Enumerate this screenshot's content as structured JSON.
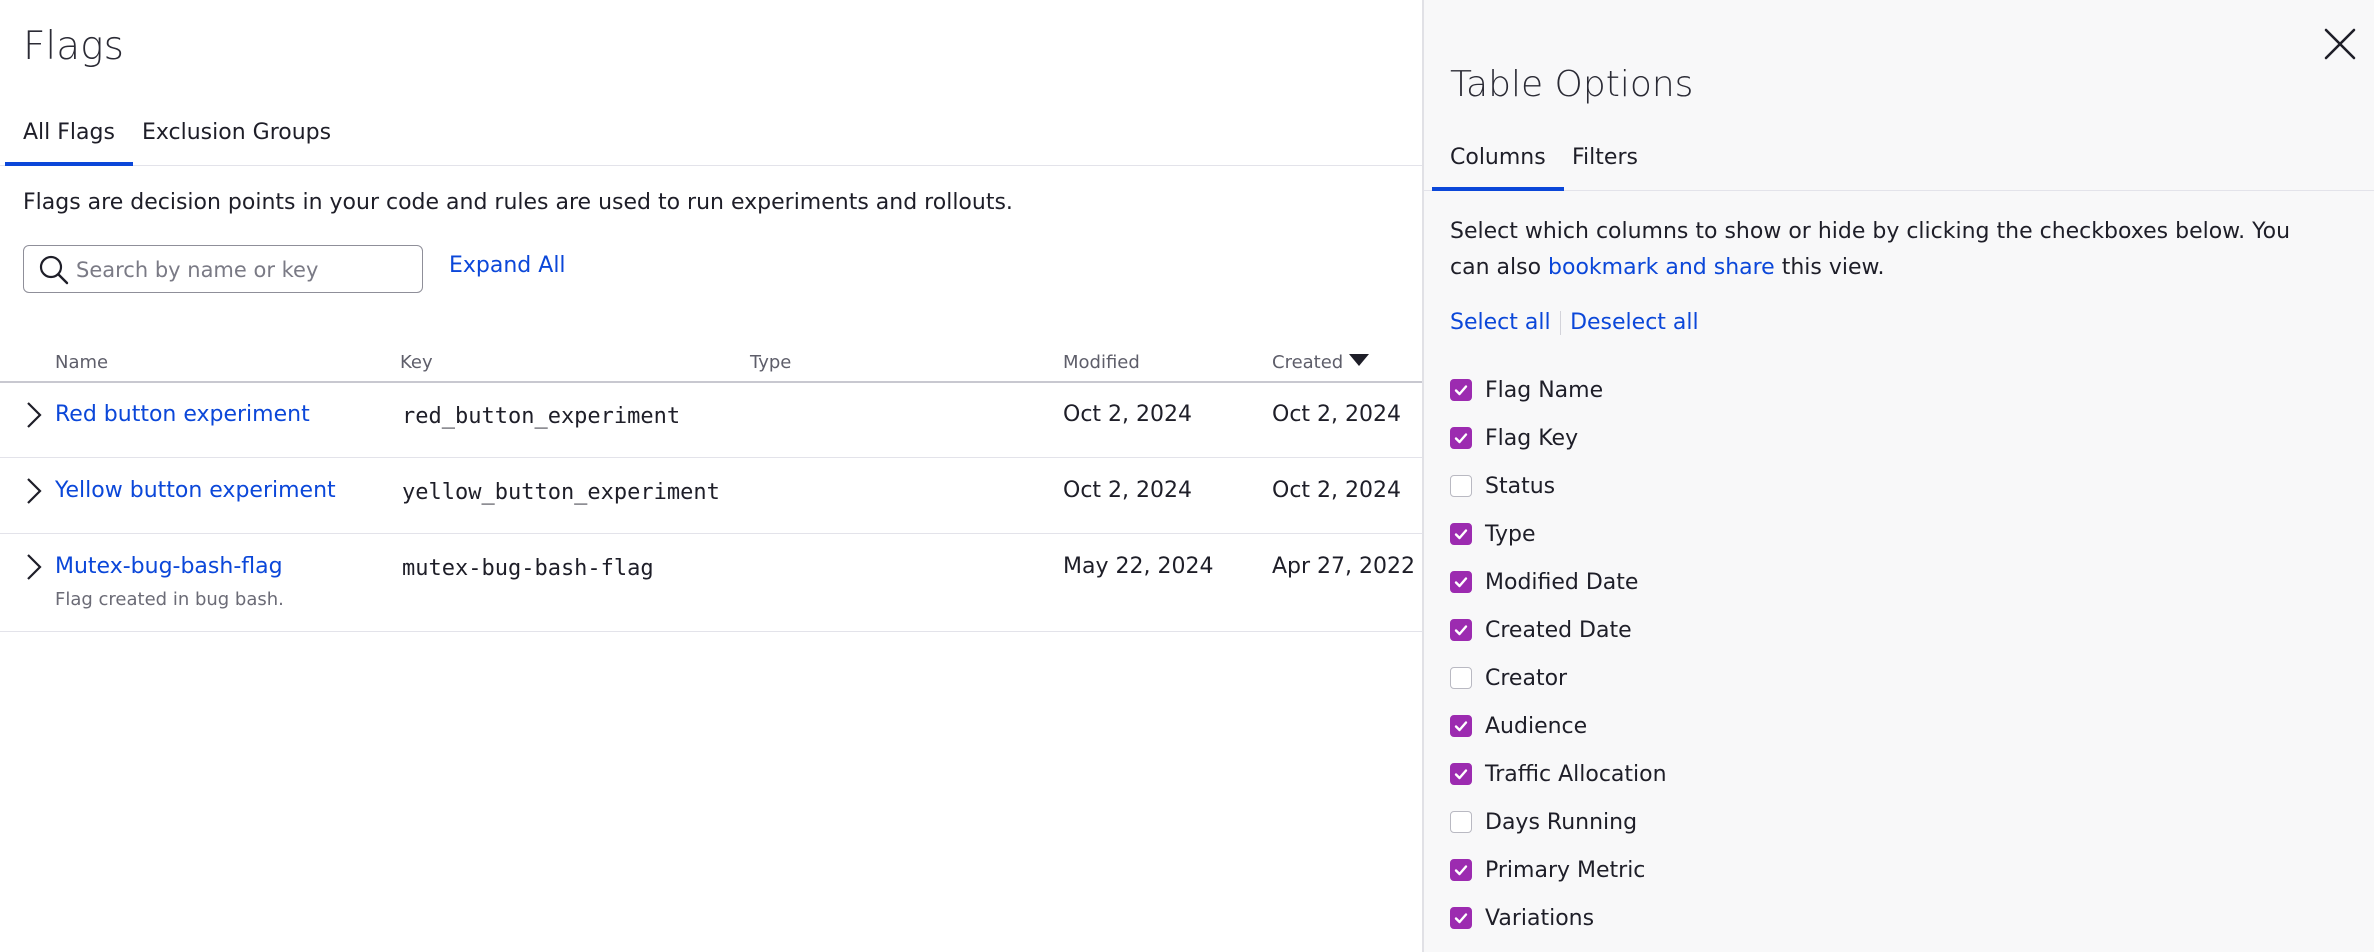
{
  "page": {
    "title": "Flags",
    "tabs": [
      {
        "label": "All Flags",
        "active": true
      },
      {
        "label": "Exclusion Groups",
        "active": false
      }
    ],
    "description": "Flags are decision points in your code and rules are used to run experiments and rollouts.",
    "search": {
      "placeholder": "Search by name or key",
      "value": ""
    },
    "expand_all_label": "Expand All"
  },
  "table": {
    "columns": [
      "Name",
      "Key",
      "Type",
      "Modified",
      "Created"
    ],
    "sort": {
      "column": "Created",
      "direction": "desc"
    },
    "rows": [
      {
        "name": "Red button experiment",
        "key": "red_button_experiment",
        "type": "",
        "modified": "Oct 2, 2024",
        "created": "Oct 2, 2024",
        "description": ""
      },
      {
        "name": "Yellow button experiment",
        "key": "yellow_button_experiment",
        "type": "",
        "modified": "Oct 2, 2024",
        "created": "Oct 2, 2024",
        "description": ""
      },
      {
        "name": "Mutex-bug-bash-flag",
        "key": "mutex-bug-bash-flag",
        "type": "",
        "modified": "May 22, 2024",
        "created": "Apr 27, 2022",
        "description": "Flag created in bug bash."
      }
    ]
  },
  "panel": {
    "title": "Table Options",
    "tabs": [
      {
        "label": "Columns",
        "active": true
      },
      {
        "label": "Filters",
        "active": false
      }
    ],
    "desc_text_1": "Select which columns to show or hide by clicking the checkboxes below. You can also ",
    "desc_link": "bookmark and share",
    "desc_text_2": " this view.",
    "select_all": "Select all",
    "deselect_all": "Deselect all",
    "columns": [
      {
        "label": "Flag Name",
        "checked": true
      },
      {
        "label": "Flag Key",
        "checked": true
      },
      {
        "label": "Status",
        "checked": false
      },
      {
        "label": "Type",
        "checked": true
      },
      {
        "label": "Modified Date",
        "checked": true
      },
      {
        "label": "Created Date",
        "checked": true
      },
      {
        "label": "Creator",
        "checked": false
      },
      {
        "label": "Audience",
        "checked": true
      },
      {
        "label": "Traffic Allocation",
        "checked": true
      },
      {
        "label": "Days Running",
        "checked": false
      },
      {
        "label": "Primary Metric",
        "checked": true
      },
      {
        "label": "Variations",
        "checked": true
      }
    ]
  },
  "colors": {
    "link": "#0b47d9",
    "checkbox_checked": "#9c2bb0",
    "panel_background": "#f8f8f9"
  },
  "icons": {
    "search": "search-icon",
    "expand_row": "chevron-right-icon",
    "sort": "caret-down-icon",
    "close": "close-icon",
    "checkbox": "checkmark-icon"
  }
}
